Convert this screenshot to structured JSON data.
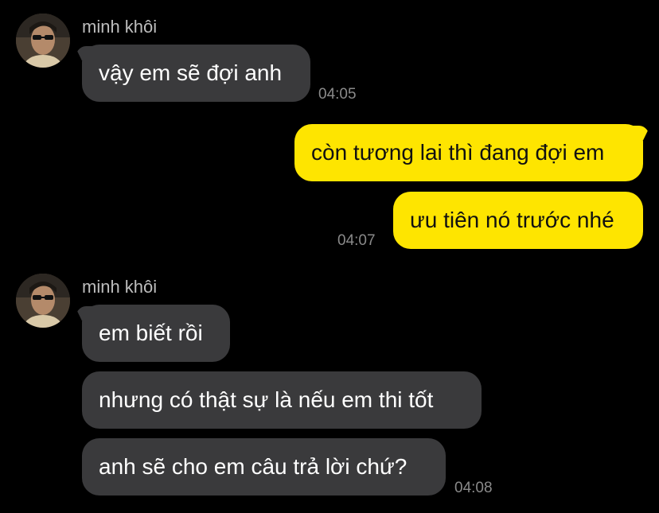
{
  "groups": [
    {
      "sender": "minh khôi",
      "messages": [
        "vậy em sẽ đợi anh"
      ],
      "time": "04:05"
    },
    {
      "messages": [
        "còn tương lai thì đang đợi em",
        "ưu tiên nó trước nhé"
      ],
      "time": "04:07"
    },
    {
      "sender": "minh khôi",
      "messages": [
        "em biết rồi",
        "nhưng có thật sự là nếu em thi tốt",
        "anh sẽ cho em câu trả lời chứ?"
      ],
      "time": "04:08"
    }
  ],
  "colors": {
    "background": "#000000",
    "incoming_bubble": "#3a3a3c",
    "outgoing_bubble": "#fee500",
    "timestamp": "#8a8a8a",
    "sender_name": "#bdbdbd"
  }
}
